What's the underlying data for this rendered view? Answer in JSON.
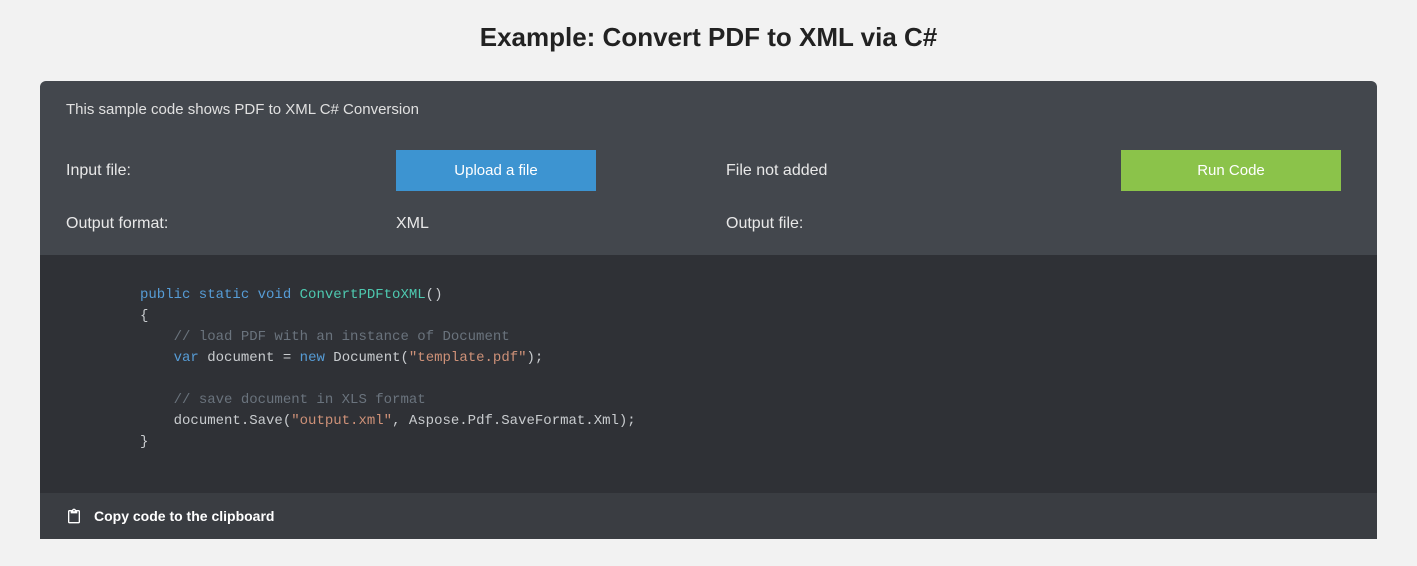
{
  "title": "Example: Convert PDF to XML via C#",
  "description": "This sample code shows PDF to XML C# Conversion",
  "form": {
    "input_label": "Input file:",
    "upload_label": "Upload a file",
    "file_status": "File not added",
    "run_label": "Run Code",
    "output_format_label": "Output format:",
    "output_format_value": "XML",
    "output_file_label": "Output file:",
    "output_file_value": ""
  },
  "code": {
    "kw1": "public static void",
    "fn": "ConvertPDFtoXML",
    "paren_open": "()",
    "brace_open": "{",
    "comment1": "// load PDF with an instance of Document",
    "var_kw": "var",
    "var_name": "document",
    "eq": " = ",
    "new_kw": "new",
    "ctor": " Document(",
    "str1": "\"template.pdf\"",
    "ctor_end": ");",
    "comment2": "// save document in XLS format",
    "save_call_a": "document.Save(",
    "str2": "\"output.xml\"",
    "save_call_b": ", Aspose.Pdf.SaveFormat.Xml);",
    "brace_close": "}"
  },
  "footer": {
    "copy_label": "Copy code to the clipboard"
  }
}
